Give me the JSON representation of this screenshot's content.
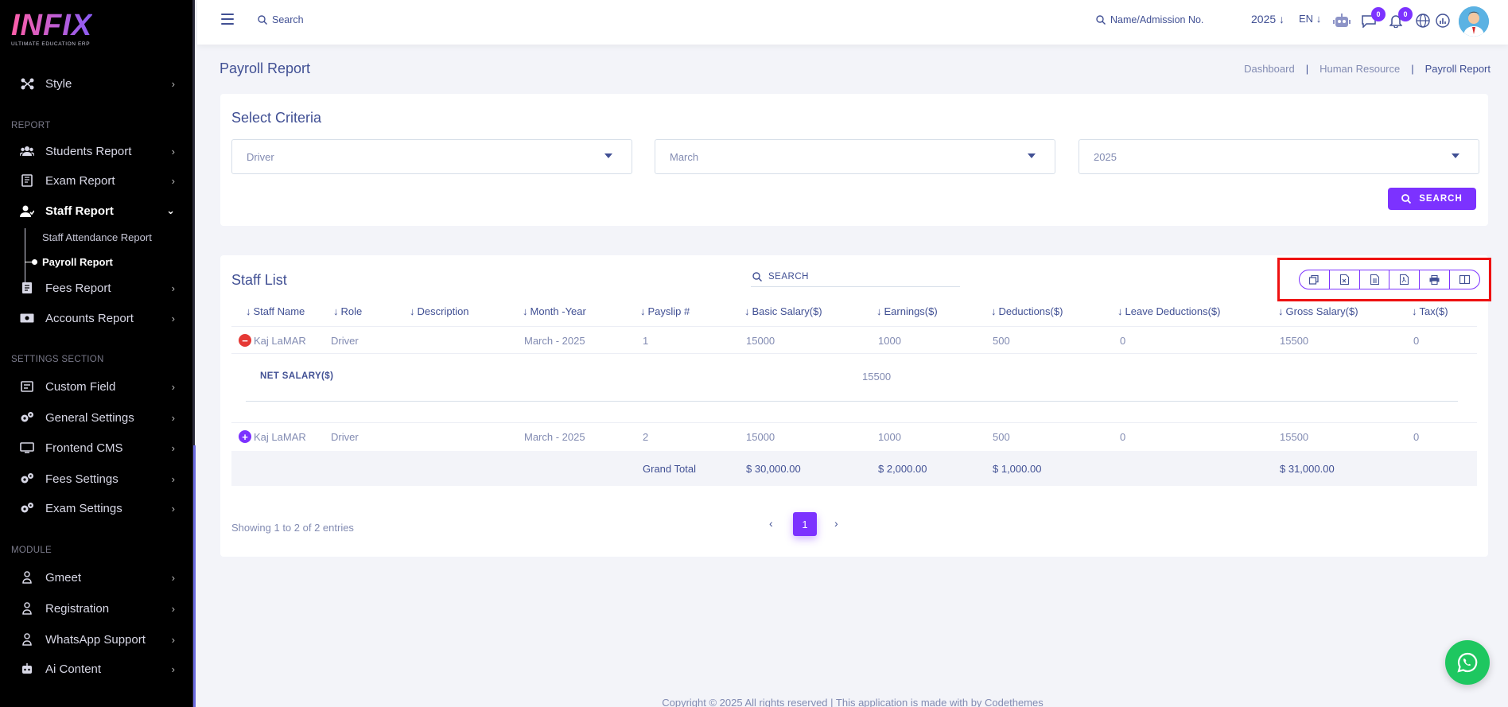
{
  "brand": {
    "logo": "INFIX",
    "tagline": "ULTIMATE EDUCATION ERP"
  },
  "sidebar": {
    "items_top": [
      {
        "label": "Style",
        "icon": "style-icon"
      }
    ],
    "section_report": "REPORT",
    "report_items": [
      {
        "label": "Students Report",
        "icon": "users-icon"
      },
      {
        "label": "Exam Report",
        "icon": "book-icon"
      },
      {
        "label": "Staff Report",
        "icon": "staff-icon"
      }
    ],
    "staff_sub": [
      "Staff Attendance Report",
      "Payroll Report"
    ],
    "report_items_2": [
      {
        "label": "Fees Report",
        "icon": "fees-icon"
      },
      {
        "label": "Accounts Report",
        "icon": "money-icon"
      }
    ],
    "section_settings": "SETTINGS SECTION",
    "settings_items": [
      {
        "label": "Custom Field",
        "icon": "field-icon"
      },
      {
        "label": "General Settings",
        "icon": "gears-icon"
      },
      {
        "label": "Frontend CMS",
        "icon": "cms-icon"
      },
      {
        "label": "Fees Settings",
        "icon": "gears-icon"
      },
      {
        "label": "Exam Settings",
        "icon": "gears-icon"
      }
    ],
    "section_module": "MODULE",
    "module_items": [
      {
        "label": "Gmeet",
        "icon": "module-icon"
      },
      {
        "label": "Registration",
        "icon": "module-icon"
      },
      {
        "label": "WhatsApp Support",
        "icon": "module-icon"
      },
      {
        "label": "Ai Content",
        "icon": "robot-icon"
      }
    ]
  },
  "topbar": {
    "search_placeholder": "Search",
    "admission_placeholder": "Name/Admission No.",
    "year": "2025",
    "lang": "EN",
    "chat_badge": "0",
    "notif_badge": "0"
  },
  "page": {
    "title": "Payroll Report",
    "breadcrumb": [
      "Dashboard",
      "Human Resource",
      "Payroll Report"
    ],
    "breadcrumb_sep": "|"
  },
  "criteria": {
    "title": "Select Criteria",
    "role": "Driver",
    "month": "March",
    "year": "2025",
    "search_button": "SEARCH"
  },
  "staff_list": {
    "title": "Staff List",
    "search_placeholder": "SEARCH",
    "columns": [
      "Staff Name",
      "Role",
      "Description",
      "Month -Year",
      "Payslip #",
      "Basic Salary($)",
      "Earnings($)",
      "Deductions($)",
      "Leave Deductions($)",
      "Gross Salary($)",
      "Tax($)"
    ],
    "rows": [
      {
        "name": "Kaj LaMAR",
        "role": "Driver",
        "description": "",
        "month_year": "March - 2025",
        "payslip": "1",
        "basic": "15000",
        "earnings": "1000",
        "deductions": "500",
        "leave": "0",
        "gross": "15500",
        "tax": "0",
        "expanded": true
      },
      {
        "name": "Kaj LaMAR",
        "role": "Driver",
        "description": "",
        "month_year": "March - 2025",
        "payslip": "2",
        "basic": "15000",
        "earnings": "1000",
        "deductions": "500",
        "leave": "0",
        "gross": "15500",
        "tax": "0",
        "expanded": false
      }
    ],
    "net_salary_label": "NET SALARY($)",
    "net_salary_value": "15500",
    "grand_total_label": "Grand Total",
    "grand_basic": "$ 30,000.00",
    "grand_earnings": "$ 2,000.00",
    "grand_deductions": "$ 1,000.00",
    "grand_gross": "$ 31,000.00",
    "showing": "Showing 1 to 2 of 2 entries",
    "page": "1",
    "prev": "‹",
    "next": "›"
  },
  "footer": "Copyright © 2025 All rights reserved | This application is made with by Codethemes",
  "colors": {
    "accent": "#7c32ff",
    "text": "#415094",
    "muted": "#828bb2",
    "whatsapp": "#1ec760",
    "highlight": "#ee1111"
  }
}
